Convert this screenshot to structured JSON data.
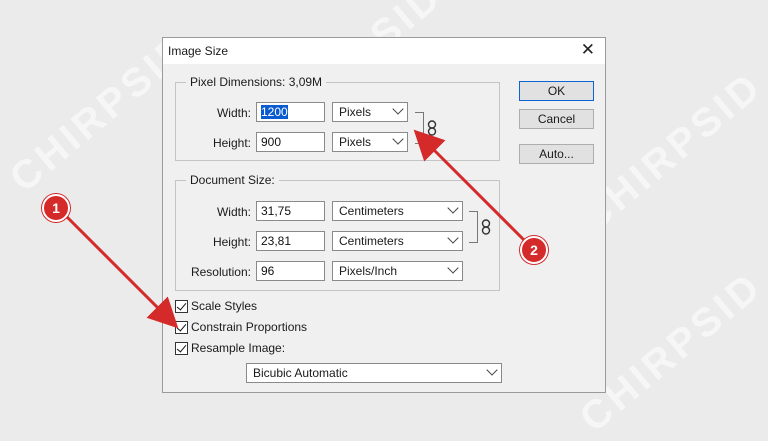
{
  "watermark": "CHIRPSID",
  "dialog": {
    "title": "Image Size",
    "close_symbol": "✕"
  },
  "pixel_dimensions": {
    "legend": "Pixel Dimensions:  3,09M",
    "width_label": "Width:",
    "width_value": "1200",
    "width_unit": "Pixels",
    "height_label": "Height:",
    "height_value": "900",
    "height_unit": "Pixels"
  },
  "document_size": {
    "legend": "Document Size:",
    "width_label": "Width:",
    "width_value": "31,75",
    "width_unit": "Centimeters",
    "height_label": "Height:",
    "height_value": "23,81",
    "height_unit": "Centimeters",
    "resolution_label": "Resolution:",
    "resolution_value": "96",
    "resolution_unit": "Pixels/Inch"
  },
  "buttons": {
    "ok": "OK",
    "cancel": "Cancel",
    "auto": "Auto..."
  },
  "options": {
    "scale_styles": "Scale Styles",
    "constrain_proportions": "Constrain Proportions",
    "resample_image": "Resample Image:",
    "resample_method": "Bicubic Automatic"
  },
  "annotations": {
    "badge_1": "1",
    "badge_2": "2",
    "color": "#d42a2a"
  }
}
